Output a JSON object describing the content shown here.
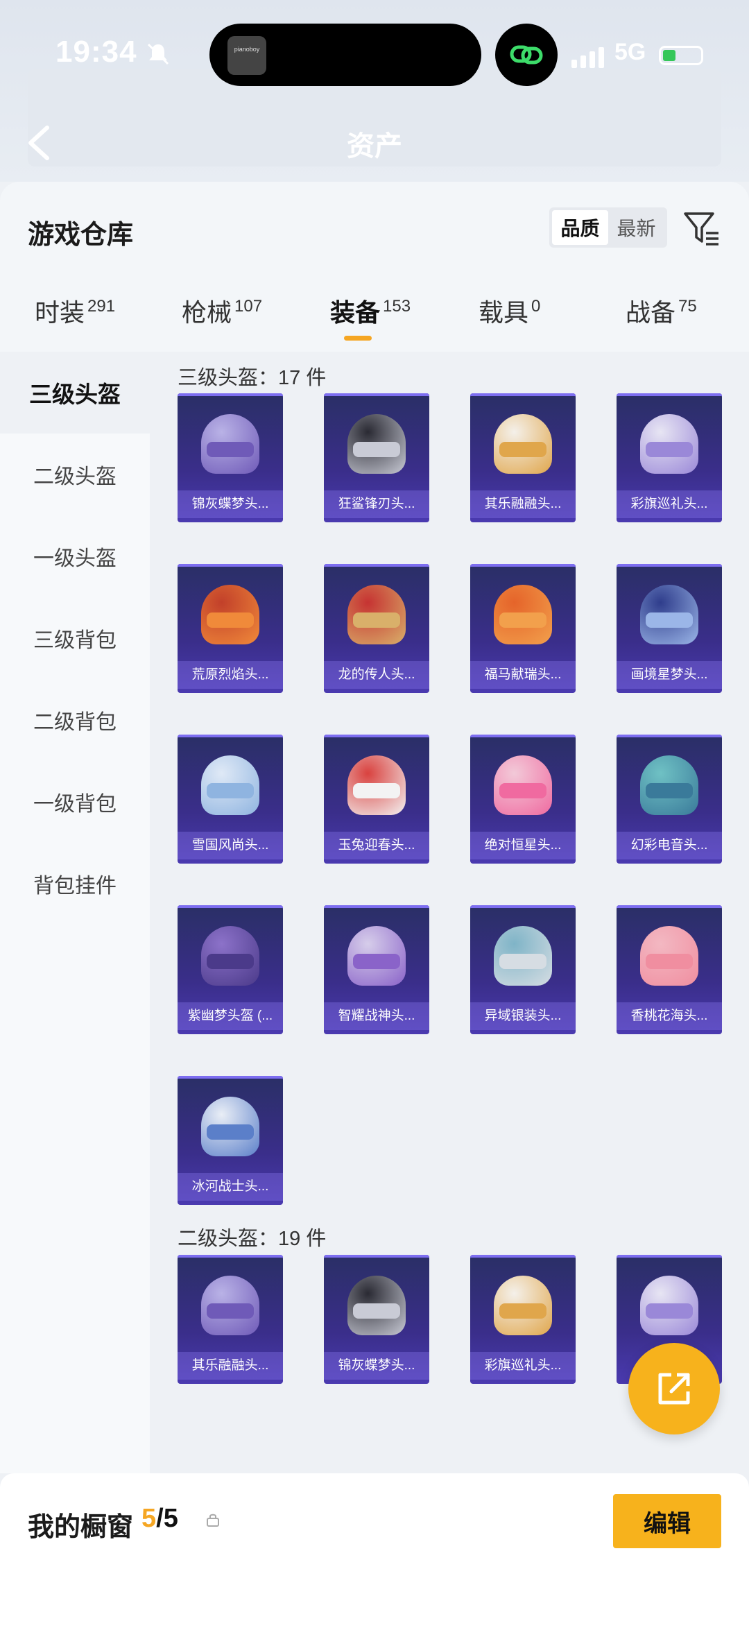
{
  "status_bar": {
    "time": "19:34",
    "network": "5G",
    "island_app": "pianoboy"
  },
  "header": {
    "title": "资产"
  },
  "sheet": {
    "title": "游戏仓库",
    "sort": {
      "options": [
        "品质",
        "最新"
      ],
      "selected": "品质"
    }
  },
  "tabs": [
    {
      "label": "时装",
      "count": "291"
    },
    {
      "label": "枪械",
      "count": "107"
    },
    {
      "label": "装备",
      "count": "153",
      "active": true
    },
    {
      "label": "载具",
      "count": "0"
    },
    {
      "label": "战备",
      "count": "75"
    }
  ],
  "sidebar": [
    "三级头盔",
    "二级头盔",
    "一级头盔",
    "三级背包",
    "二级背包",
    "一级背包",
    "背包挂件"
  ],
  "sections": [
    {
      "title": "三级头盔：17 件",
      "items": [
        "锦灰蝶梦头...",
        "狂鲨锋刃头...",
        "其乐融融头...",
        "彩旗巡礼头...",
        "荒原烈焰头...",
        "龙的传人头...",
        "福马献瑞头...",
        "画境星梦头...",
        "雪国风尚头...",
        "玉兔迎春头...",
        "绝对恒星头...",
        "幻彩电音头...",
        "紫幽梦头盔 (...",
        "智耀战神头...",
        "异域银装头...",
        "香桃花海头...",
        "冰河战士头..."
      ]
    },
    {
      "title": "二级头盔：19 件",
      "items": [
        "其乐融融头...",
        "锦灰蝶梦头...",
        "彩旗巡礼头...",
        ""
      ]
    }
  ],
  "bottom_bar": {
    "label": "我的橱窗",
    "count_current": "5",
    "count_total": "/5",
    "edit_label": "编辑"
  },
  "colors": {
    "accent": "#f7b21c",
    "card_bg": "#3a2e8a",
    "tab_indicator": "#f5a623"
  }
}
